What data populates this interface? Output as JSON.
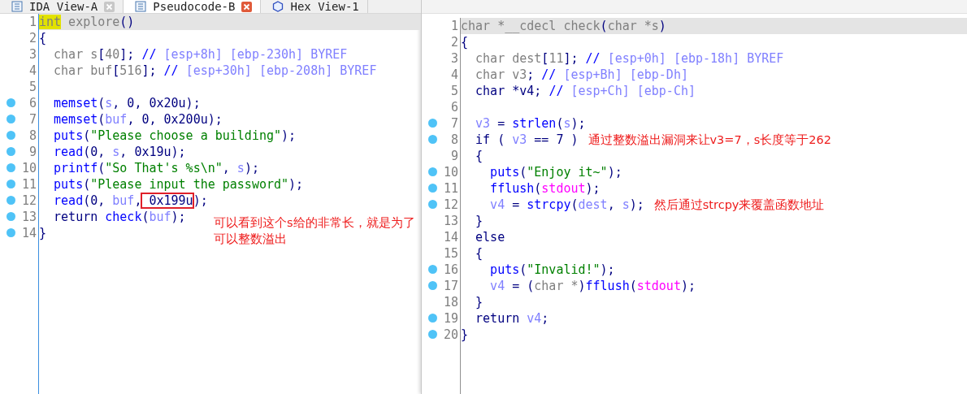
{
  "tabs": [
    {
      "label": "IDA View-A",
      "selected": false
    },
    {
      "label": "Pseudocode-B",
      "selected": true
    },
    {
      "label": "Hex View-1",
      "selected": false
    }
  ],
  "left_code": {
    "lines": [
      {
        "num": "1",
        "breakpoint": false,
        "current": true,
        "tokens": [
          {
            "text": "int",
            "kind": "hl"
          },
          {
            "text": " explore",
            "kind": "type"
          },
          {
            "text": "()",
            "kind": "punc"
          }
        ]
      },
      {
        "num": "2",
        "breakpoint": false,
        "current": false,
        "tokens": [
          {
            "text": "{",
            "kind": "punc"
          }
        ]
      },
      {
        "num": "3",
        "breakpoint": false,
        "current": false,
        "tokens": [
          {
            "text": "  char s",
            "kind": "type"
          },
          {
            "text": "[",
            "kind": "punc"
          },
          {
            "text": "40",
            "kind": "type"
          },
          {
            "text": "]; ",
            "kind": "punc"
          },
          {
            "text": "// ",
            "kind": "cmt"
          },
          {
            "text": "[esp+8h] [ebp-230h] BYREF",
            "kind": "loc"
          }
        ]
      },
      {
        "num": "4",
        "breakpoint": false,
        "current": false,
        "tokens": [
          {
            "text": "  char buf",
            "kind": "type"
          },
          {
            "text": "[",
            "kind": "punc"
          },
          {
            "text": "516",
            "kind": "type"
          },
          {
            "text": "]; ",
            "kind": "punc"
          },
          {
            "text": "// ",
            "kind": "cmt"
          },
          {
            "text": "[esp+30h] [ebp-208h] BYREF",
            "kind": "loc"
          }
        ]
      },
      {
        "num": "5",
        "breakpoint": false,
        "current": false
      },
      {
        "num": "6",
        "breakpoint": true,
        "current": false,
        "tokens": [
          {
            "text": "  memset",
            "kind": "func"
          },
          {
            "text": "(",
            "kind": "punc"
          },
          {
            "text": "s",
            "kind": "var"
          },
          {
            "text": ", 0, 0x20u);",
            "kind": "punc"
          }
        ]
      },
      {
        "num": "7",
        "breakpoint": true,
        "current": false,
        "tokens": [
          {
            "text": "  memset",
            "kind": "func"
          },
          {
            "text": "(",
            "kind": "punc"
          },
          {
            "text": "buf",
            "kind": "var"
          },
          {
            "text": ", 0, 0x200u);",
            "kind": "punc"
          }
        ]
      },
      {
        "num": "8",
        "breakpoint": true,
        "current": false,
        "tokens": [
          {
            "text": "  puts",
            "kind": "func"
          },
          {
            "text": "(",
            "kind": "punc"
          },
          {
            "text": "\"Please choose a building\"",
            "kind": "str"
          },
          {
            "text": ");",
            "kind": "punc"
          }
        ]
      },
      {
        "num": "9",
        "breakpoint": true,
        "current": false,
        "tokens": [
          {
            "text": "  read",
            "kind": "func"
          },
          {
            "text": "(0, ",
            "kind": "punc"
          },
          {
            "text": "s",
            "kind": "var"
          },
          {
            "text": ", 0x19u);",
            "kind": "punc"
          }
        ]
      },
      {
        "num": "10",
        "breakpoint": true,
        "current": false,
        "tokens": [
          {
            "text": "  printf",
            "kind": "func"
          },
          {
            "text": "(",
            "kind": "punc"
          },
          {
            "text": "\"So That's %s\\n\"",
            "kind": "str"
          },
          {
            "text": ", ",
            "kind": "punc"
          },
          {
            "text": "s",
            "kind": "var"
          },
          {
            "text": ");",
            "kind": "punc"
          }
        ]
      },
      {
        "num": "11",
        "breakpoint": true,
        "current": false,
        "tokens": [
          {
            "text": "  puts",
            "kind": "func"
          },
          {
            "text": "(",
            "kind": "punc"
          },
          {
            "text": "\"Please input the password\"",
            "kind": "str"
          },
          {
            "text": ");",
            "kind": "punc"
          }
        ]
      },
      {
        "num": "12",
        "breakpoint": true,
        "current": false,
        "tokens": [
          {
            "text": "  read",
            "kind": "func"
          },
          {
            "text": "(0, ",
            "kind": "punc"
          },
          {
            "text": "buf",
            "kind": "var"
          },
          {
            "text": ",",
            "kind": "punc"
          },
          {
            "text": " 0x199u",
            "kind": "boxed"
          },
          {
            "text": ");",
            "kind": "punc"
          }
        ]
      },
      {
        "num": "13",
        "breakpoint": true,
        "current": false,
        "tokens": [
          {
            "text": "  return ",
            "kind": "punc"
          },
          {
            "text": "check",
            "kind": "func"
          },
          {
            "text": "(",
            "kind": "punc"
          },
          {
            "text": "buf",
            "kind": "var"
          },
          {
            "text": ");",
            "kind": "punc"
          }
        ]
      },
      {
        "num": "14",
        "breakpoint": true,
        "current": false,
        "tokens": [
          {
            "text": "}",
            "kind": "punc"
          }
        ]
      }
    ]
  },
  "left_note": {
    "lines": [
      "可以看到这个s给的非常长，就是为了",
      "可以整数溢出"
    ]
  },
  "right_code": {
    "lines": [
      {
        "num": "1",
        "breakpoint": false,
        "current": true,
        "tokens": [
          {
            "text": "char *__cdecl check",
            "kind": "type"
          },
          {
            "text": "(",
            "kind": "punc"
          },
          {
            "text": "char *s",
            "kind": "type"
          },
          {
            "text": ")",
            "kind": "punc"
          }
        ]
      },
      {
        "num": "2",
        "breakpoint": false,
        "current": false,
        "tokens": [
          {
            "text": "{",
            "kind": "punc"
          }
        ]
      },
      {
        "num": "3",
        "breakpoint": false,
        "current": false,
        "tokens": [
          {
            "text": "  char dest",
            "kind": "type"
          },
          {
            "text": "[",
            "kind": "punc"
          },
          {
            "text": "11",
            "kind": "type"
          },
          {
            "text": "]; ",
            "kind": "punc"
          },
          {
            "text": "// ",
            "kind": "cmt"
          },
          {
            "text": "[esp+0h] [ebp-18h] BYREF",
            "kind": "loc"
          }
        ]
      },
      {
        "num": "4",
        "breakpoint": false,
        "current": false,
        "tokens": [
          {
            "text": "  char v3",
            "kind": "type"
          },
          {
            "text": "; ",
            "kind": "punc"
          },
          {
            "text": "// ",
            "kind": "cmt"
          },
          {
            "text": "[esp+Bh] [ebp-Dh]",
            "kind": "loc"
          }
        ]
      },
      {
        "num": "5",
        "breakpoint": false,
        "current": false,
        "tokens": [
          {
            "text": "  char *v4; ",
            "kind": "punc"
          },
          {
            "text": "// ",
            "kind": "cmt"
          },
          {
            "text": "[esp+Ch] [ebp-Ch]",
            "kind": "loc"
          }
        ]
      },
      {
        "num": "6",
        "breakpoint": false,
        "current": false
      },
      {
        "num": "7",
        "breakpoint": true,
        "current": false,
        "tokens": [
          {
            "text": "  v3",
            "kind": "var"
          },
          {
            "text": " = ",
            "kind": "punc"
          },
          {
            "text": "strlen",
            "kind": "func"
          },
          {
            "text": "(",
            "kind": "punc"
          },
          {
            "text": "s",
            "kind": "var"
          },
          {
            "text": ");",
            "kind": "punc"
          }
        ]
      },
      {
        "num": "8",
        "breakpoint": true,
        "current": false,
        "tokens": [
          {
            "text": "  if ( ",
            "kind": "punc"
          },
          {
            "text": "v3",
            "kind": "var"
          },
          {
            "text": " == 7 )",
            "kind": "punc"
          }
        ],
        "note": "通过整数溢出漏洞来让v3=7，s长度等于262"
      },
      {
        "num": "9",
        "breakpoint": false,
        "current": false,
        "tokens": [
          {
            "text": "  {",
            "kind": "punc"
          }
        ]
      },
      {
        "num": "10",
        "breakpoint": true,
        "current": false,
        "tokens": [
          {
            "text": "    puts",
            "kind": "func"
          },
          {
            "text": "(",
            "kind": "punc"
          },
          {
            "text": "\"Enjoy it~\"",
            "kind": "str"
          },
          {
            "text": ");",
            "kind": "punc"
          }
        ]
      },
      {
        "num": "11",
        "breakpoint": true,
        "current": false,
        "tokens": [
          {
            "text": "    fflush",
            "kind": "func"
          },
          {
            "text": "(",
            "kind": "punc"
          },
          {
            "text": "stdout",
            "kind": "glob"
          },
          {
            "text": ");",
            "kind": "punc"
          }
        ]
      },
      {
        "num": "12",
        "breakpoint": true,
        "current": false,
        "tokens": [
          {
            "text": "    v4",
            "kind": "var"
          },
          {
            "text": " = ",
            "kind": "punc"
          },
          {
            "text": "strcpy",
            "kind": "func"
          },
          {
            "text": "(",
            "kind": "punc"
          },
          {
            "text": "dest",
            "kind": "var"
          },
          {
            "text": ", ",
            "kind": "punc"
          },
          {
            "text": "s",
            "kind": "var"
          },
          {
            "text": ");",
            "kind": "punc"
          }
        ],
        "note": "然后通过strcpy来覆盖函数地址"
      },
      {
        "num": "13",
        "breakpoint": false,
        "current": false,
        "tokens": [
          {
            "text": "  }",
            "kind": "punc"
          }
        ]
      },
      {
        "num": "14",
        "breakpoint": false,
        "current": false,
        "tokens": [
          {
            "text": "  else",
            "kind": "punc"
          }
        ]
      },
      {
        "num": "15",
        "breakpoint": false,
        "current": false,
        "tokens": [
          {
            "text": "  {",
            "kind": "punc"
          }
        ]
      },
      {
        "num": "16",
        "breakpoint": true,
        "current": false,
        "tokens": [
          {
            "text": "    puts",
            "kind": "func"
          },
          {
            "text": "(",
            "kind": "punc"
          },
          {
            "text": "\"Invalid!\"",
            "kind": "str"
          },
          {
            "text": ");",
            "kind": "punc"
          }
        ]
      },
      {
        "num": "17",
        "breakpoint": true,
        "current": false,
        "tokens": [
          {
            "text": "    v4",
            "kind": "var"
          },
          {
            "text": " = (",
            "kind": "punc"
          },
          {
            "text": "char *",
            "kind": "type"
          },
          {
            "text": ")",
            "kind": "punc"
          },
          {
            "text": "fflush",
            "kind": "func"
          },
          {
            "text": "(",
            "kind": "punc"
          },
          {
            "text": "stdout",
            "kind": "glob"
          },
          {
            "text": ");",
            "kind": "punc"
          }
        ]
      },
      {
        "num": "18",
        "breakpoint": false,
        "current": false,
        "tokens": [
          {
            "text": "  }",
            "kind": "punc"
          }
        ]
      },
      {
        "num": "19",
        "breakpoint": true,
        "current": false,
        "tokens": [
          {
            "text": "  return ",
            "kind": "punc"
          },
          {
            "text": "v4",
            "kind": "var"
          },
          {
            "text": ";",
            "kind": "punc"
          }
        ]
      },
      {
        "num": "20",
        "breakpoint": true,
        "current": false,
        "tokens": [
          {
            "text": "}",
            "kind": "punc"
          }
        ]
      }
    ]
  }
}
